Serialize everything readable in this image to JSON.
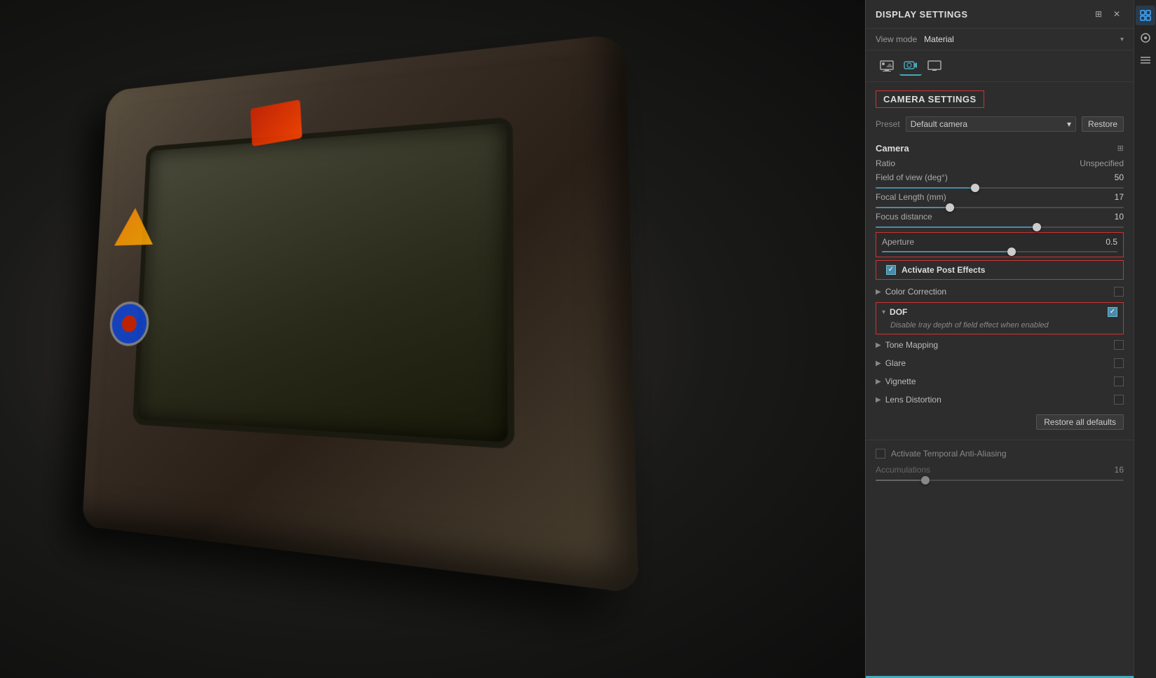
{
  "panel": {
    "title": "DISPLAY SETTINGS",
    "view_mode_label": "View mode",
    "view_mode_value": "Material",
    "camera_settings_label": "CAMERA SETTINGS",
    "preset_label": "Preset",
    "preset_value": "Default camera",
    "restore_button": "Restore",
    "camera_section_title": "Camera",
    "ratio_label": "Ratio",
    "ratio_value": "Unspecified",
    "fov_label": "Field of view (deg°)",
    "fov_value": "50",
    "fov_slider_pct": 40,
    "focal_length_label": "Focal Length (mm)",
    "focal_length_value": "17",
    "focal_slider_pct": 30,
    "focus_distance_label": "Focus distance",
    "focus_distance_value": "10",
    "focus_slider_pct": 65,
    "aperture_label": "Aperture",
    "aperture_value": "0.5",
    "aperture_slider_pct": 55,
    "activate_post_effects_label": "Activate Post Effects",
    "color_correction_label": "Color Correction",
    "dof_label": "DOF",
    "dof_description": "Disable Iray depth of field effect when enabled",
    "tone_mapping_label": "Tone Mapping",
    "glare_label": "Glare",
    "vignette_label": "Vignette",
    "lens_distortion_label": "Lens Distortion",
    "restore_all_defaults": "Restore all defaults",
    "activate_temporal_aa_label": "Activate Temporal Anti-Aliasing",
    "accumulations_label": "Accumulations",
    "accumulations_value": "16"
  },
  "tabs": {
    "tab1_icon": "🎥",
    "tab2_icon": "📷",
    "tab3_icon": "🖥"
  },
  "side_toolbar": {
    "icon1": "⊞",
    "icon2": "◎",
    "icon3": "☰"
  }
}
